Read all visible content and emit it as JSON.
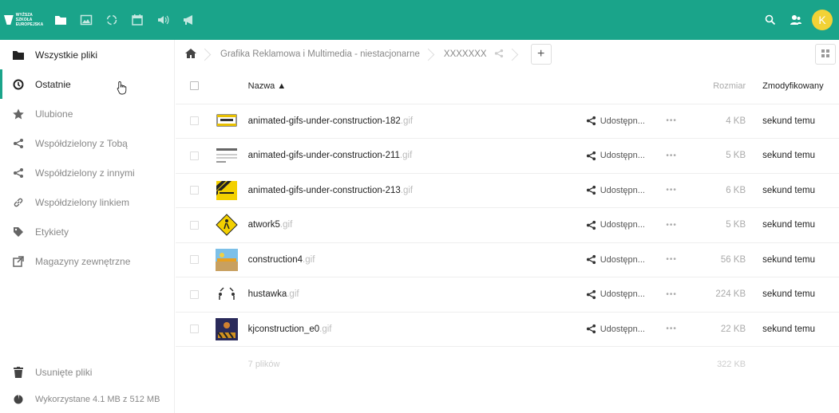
{
  "header": {
    "logo_text": "WYŻSZA SZKOŁA EUROPEJSKA",
    "avatar_letter": "K",
    "accent": "#1aa48a",
    "avatar_color": "#f2d236"
  },
  "sidebar": {
    "items": [
      {
        "label": "Wszystkie pliki",
        "icon": "folder-icon"
      },
      {
        "label": "Ostatnie",
        "icon": "clock-icon"
      },
      {
        "label": "Ulubione",
        "icon": "star-icon"
      },
      {
        "label": "Współdzielony z Tobą",
        "icon": "share-icon"
      },
      {
        "label": "Współdzielony z innymi",
        "icon": "share-icon"
      },
      {
        "label": "Współdzielony linkiem",
        "icon": "link-icon"
      },
      {
        "label": "Etykiety",
        "icon": "tag-icon"
      },
      {
        "label": "Magazyny zewnętrzne",
        "icon": "external-icon"
      }
    ],
    "trash_label": "Usunięte pliki",
    "quota_label": "Wykorzystane 4.1 MB z 512 MB"
  },
  "breadcrumb": {
    "home_icon": "home-icon",
    "items": [
      "Grafika Reklamowa i Multimedia - niestacjonarne",
      "XXXXXXX"
    ]
  },
  "table": {
    "col_name": "Nazwa ▲",
    "col_size": "Rozmiar",
    "col_modified": "Zmodyfikowany",
    "share_label": "Udostępn...",
    "more_label": "•••",
    "rows": [
      {
        "name": "animated-gifs-under-construction-182",
        "ext": ".gif",
        "size": "4 KB",
        "modified": "sekund temu"
      },
      {
        "name": "animated-gifs-under-construction-211",
        "ext": ".gif",
        "size": "5 KB",
        "modified": "sekund temu"
      },
      {
        "name": "animated-gifs-under-construction-213",
        "ext": ".gif",
        "size": "6 KB",
        "modified": "sekund temu"
      },
      {
        "name": "atwork5",
        "ext": ".gif",
        "size": "5 KB",
        "modified": "sekund temu"
      },
      {
        "name": "construction4",
        "ext": ".gif",
        "size": "56 KB",
        "modified": "sekund temu"
      },
      {
        "name": "hustawka",
        "ext": ".gif",
        "size": "224 KB",
        "modified": "sekund temu"
      },
      {
        "name": "kjconstruction_e0",
        "ext": ".gif",
        "size": "22 KB",
        "modified": "sekund temu"
      }
    ],
    "summary_count": "7 plików",
    "summary_size": "322 KB"
  }
}
